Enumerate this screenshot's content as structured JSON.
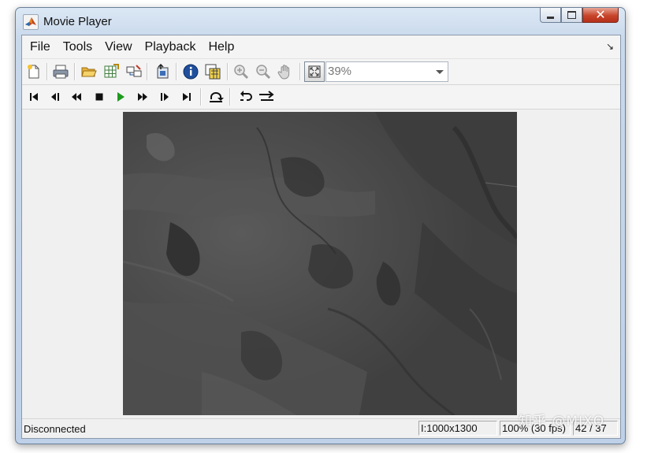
{
  "window": {
    "title": "Movie Player",
    "controls": {
      "minimize": "minimize",
      "maximize": "maximize",
      "close": "✕"
    }
  },
  "menu": {
    "items": [
      "File",
      "Tools",
      "View",
      "Playback",
      "Help"
    ],
    "corner_glyph": "↘"
  },
  "toolbar": {
    "zoom_value": "39%"
  },
  "playback_toolbar": {
    "buttons": [
      "go-to-first-frame",
      "step-back",
      "rewind",
      "stop",
      "play",
      "fast-forward",
      "step-forward",
      "go-to-last-frame",
      "jump-to",
      "repeat",
      "forward-backward-playback"
    ]
  },
  "status": {
    "connection": "Disconnected",
    "image_size": "I:1000x1300",
    "speed": "100% (30 fps)",
    "frame": "42 / 37"
  },
  "watermark": "知乎 @MIXQ",
  "colors": {
    "play_green": "#1d9a1d",
    "close_red": "#c7442a",
    "info_blue": "#1f4f9c"
  }
}
